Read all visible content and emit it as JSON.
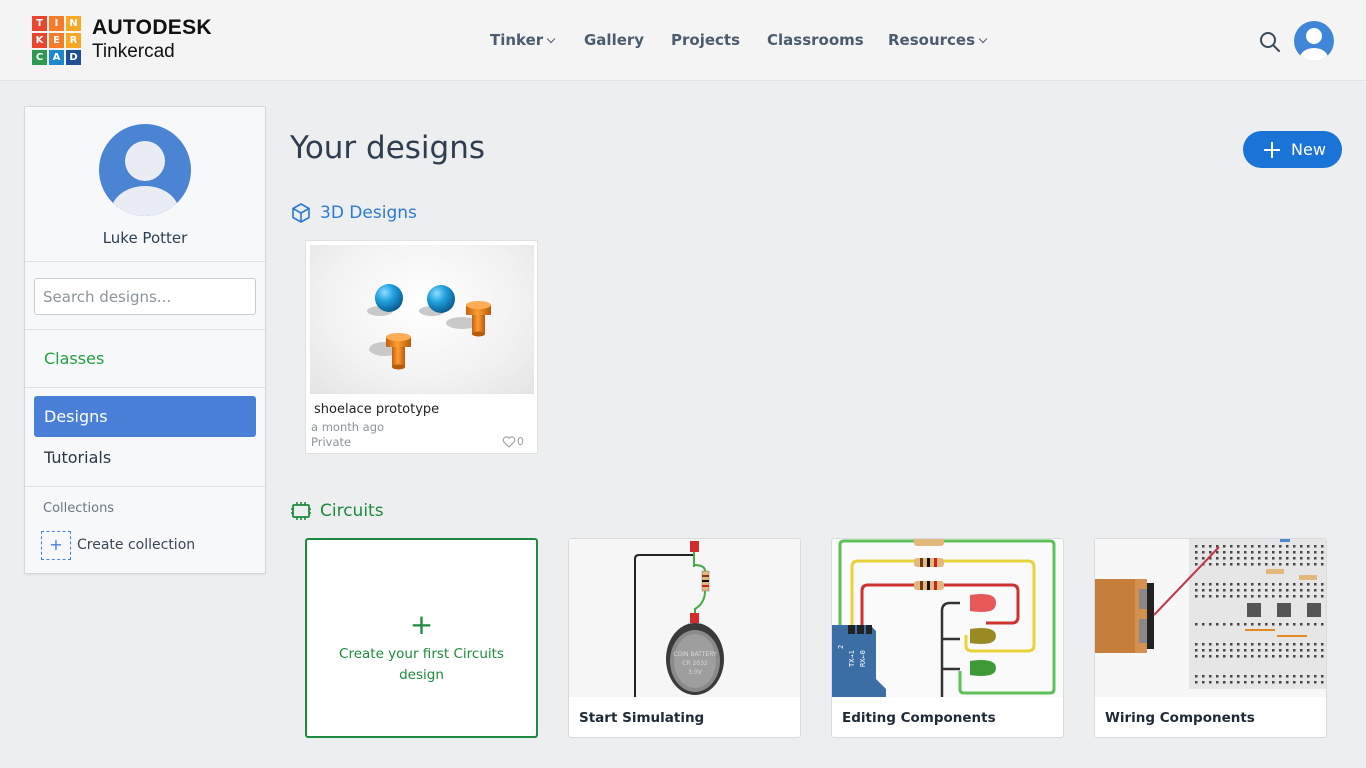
{
  "header": {
    "logo_letters": [
      "T",
      "I",
      "N",
      "K",
      "E",
      "R",
      "C",
      "A",
      "D"
    ],
    "logo_colors": [
      "#e8442e",
      "#f57c2b",
      "#f9a825",
      "#e8442e",
      "#f57c2b",
      "#f9a825",
      "#2f9a4f",
      "#1e88c8",
      "#1e4f96"
    ],
    "brand_top": "AUTODESK",
    "brand_bottom": "Tinkercad",
    "nav": [
      {
        "label": "Tinker",
        "dropdown": true
      },
      {
        "label": "Gallery",
        "dropdown": false
      },
      {
        "label": "Projects",
        "dropdown": false
      },
      {
        "label": "Classrooms",
        "dropdown": false
      },
      {
        "label": "Resources",
        "dropdown": true
      }
    ],
    "search_icon": "search-icon",
    "avatar_icon": "user-avatar-icon"
  },
  "sidebar": {
    "user_name": "Luke Potter",
    "search_placeholder": "Search designs...",
    "classes_label": "Classes",
    "designs_label": "Designs",
    "tutorials_label": "Tutorials",
    "collections_label": "Collections",
    "create_collection_label": "Create collection",
    "add_symbol": "+"
  },
  "main": {
    "title": "Your designs",
    "new_button_label": "New",
    "new_button_symbol": "+",
    "section_3d": {
      "title": "3D Designs",
      "icon": "cube-icon",
      "color": "#2a7bd4",
      "designs": [
        {
          "name": "shoelace prototype",
          "modified": "a month ago",
          "visibility": "Private",
          "likes": "0"
        }
      ]
    },
    "section_circuits": {
      "title": "Circuits",
      "icon": "chip-icon",
      "color": "#1d8b3e",
      "create_plus": "+",
      "create_label": "Create your first Circuits design",
      "tutorials": [
        {
          "label": "Start Simulating",
          "battery_text": [
            "COIN BATTERY",
            "CR 2032",
            "3.0V"
          ]
        },
        {
          "label": "Editing Components",
          "pin_labels": [
            "2",
            "TX→1",
            "RX←0"
          ]
        },
        {
          "label": "Wiring Components"
        }
      ]
    }
  },
  "colors": {
    "accent_blue": "#1a73d6",
    "sidebar_active": "#4a7fd8",
    "green": "#1d8b3e",
    "sphere_blue": "#22a2e0",
    "peg_orange": "#f08a1e"
  }
}
